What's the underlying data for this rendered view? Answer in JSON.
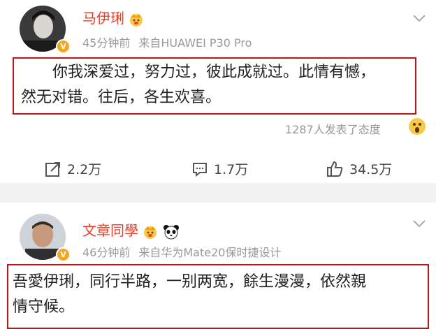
{
  "post1": {
    "user_name": "马伊琍",
    "time": "45分钟前",
    "source": "来自HUAWEI P30 Pro",
    "content_line1": "你我深爱过，努力过，彼此成就过。此情有憾，",
    "content_line2": "然无对错。往后，各生欢喜。",
    "reactions": "1287人发表了态度",
    "reposts": "2.2万",
    "comments": "1.7万",
    "likes": "34.5万"
  },
  "post2": {
    "user_name": "文章同學",
    "time": "46分钟前",
    "source": "来自华为Mate20保时捷设计",
    "content_line1": "吾愛伊琍，同行半路，一别两宽，餘生漫漫，依然親",
    "content_line2": "情守候。"
  },
  "colors": {
    "name": "#e8402a",
    "highlight_border": "#c4141a",
    "verified_badge": "#f5a623"
  }
}
